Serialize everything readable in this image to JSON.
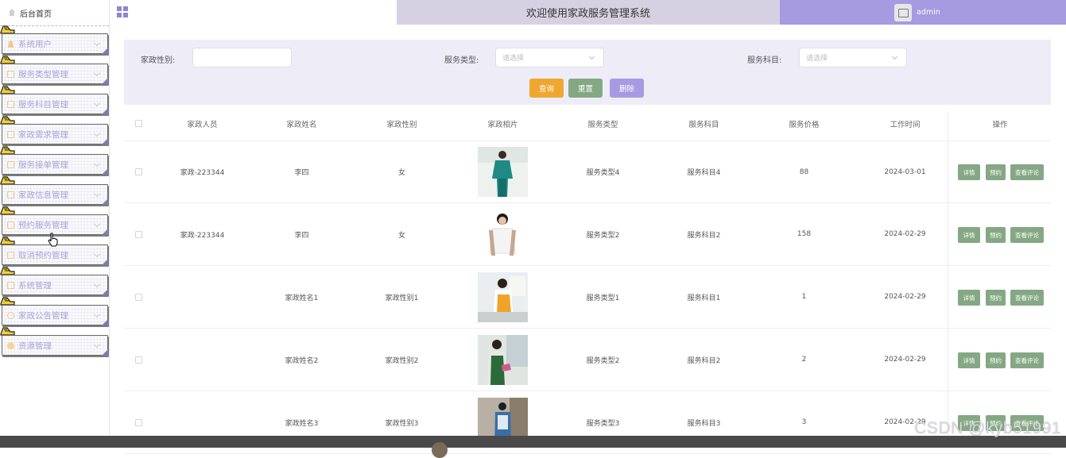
{
  "sidebar": {
    "home_label": "后台首页",
    "items": [
      {
        "label": "系统用户",
        "icon": "user-icon"
      },
      {
        "label": "服务类型管理",
        "icon": "doc-icon"
      },
      {
        "label": "服务科目管理",
        "icon": "doc-icon"
      },
      {
        "label": "家政需求管理",
        "icon": "doc-icon"
      },
      {
        "label": "服务接单管理",
        "icon": "doc-icon"
      },
      {
        "label": "家政信息管理",
        "icon": "doc-icon"
      },
      {
        "label": "预约服务管理",
        "icon": "doc-icon"
      },
      {
        "label": "取消预约管理",
        "icon": "doc-icon"
      },
      {
        "label": "系统管理",
        "icon": "doc-icon"
      },
      {
        "label": "家政公告管理",
        "icon": "info-icon"
      },
      {
        "label": "资源管理",
        "icon": "bulb-icon"
      }
    ]
  },
  "header": {
    "title": "欢迎使用家政服务管理系统",
    "username": "admin"
  },
  "search": {
    "gender_label": "家政性别:",
    "gender_value": "",
    "service_type_label": "服务类型:",
    "service_type_placeholder": "请选择",
    "service_subject_label": "服务科目:",
    "service_subject_placeholder": "请选择",
    "query_button": "查询",
    "reset_button": "重置",
    "delete_button": "删除"
  },
  "colors": {
    "header_mid": "#d6d1e2",
    "header_right": "#a69ae0",
    "query_btn": "#f0a72f",
    "reset_btn": "#84a884",
    "delete_btn": "#a79ae2",
    "op_btn": "#84a884"
  },
  "table": {
    "columns": [
      "家政人员",
      "家政姓名",
      "家政性别",
      "家政相片",
      "服务类型",
      "服务科目",
      "服务价格",
      "工作时间",
      "操作"
    ],
    "rows": [
      {
        "staff": "家政-223344",
        "name": "李四",
        "gender": "女",
        "service_type": "服务类型4",
        "subject": "服务科目4",
        "price": "88",
        "date": "2024-03-01"
      },
      {
        "staff": "家政-223344",
        "name": "李四",
        "gender": "女",
        "service_type": "服务类型2",
        "subject": "服务科目2",
        "price": "158",
        "date": "2024-02-29"
      },
      {
        "staff": "",
        "name": "家政姓名1",
        "gender": "家政性别1",
        "service_type": "服务类型1",
        "subject": "服务科目1",
        "price": "1",
        "date": "2024-02-29"
      },
      {
        "staff": "",
        "name": "家政姓名2",
        "gender": "家政性别2",
        "service_type": "服务类型2",
        "subject": "服务科目2",
        "price": "2",
        "date": "2024-02-29"
      },
      {
        "staff": "",
        "name": "家政姓名3",
        "gender": "家政性别3",
        "service_type": "服务类型3",
        "subject": "服务科目3",
        "price": "3",
        "date": "2024-02-29"
      }
    ],
    "ops": [
      "详情",
      "预约",
      "查看评论"
    ]
  },
  "watermark": "CSDN @kyb51991"
}
